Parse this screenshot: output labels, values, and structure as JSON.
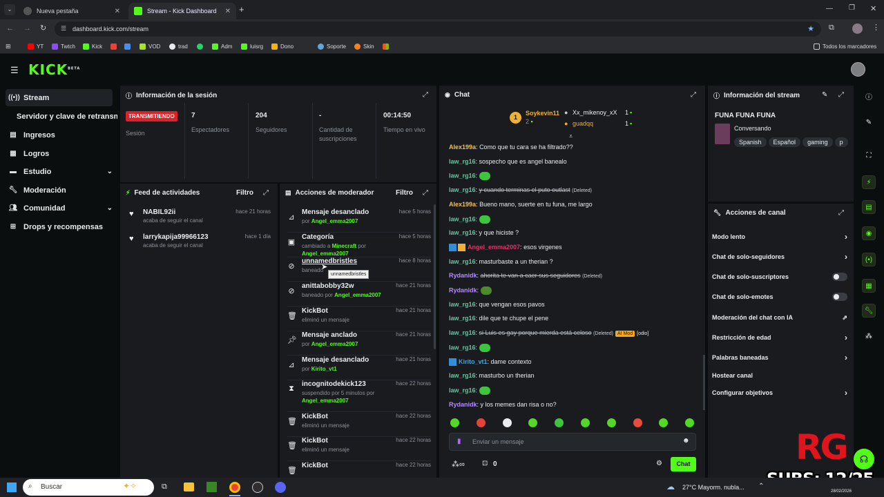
{
  "browser": {
    "tabs": [
      {
        "title": "Nueva pestaña",
        "active": false
      },
      {
        "title": "Stream - Kick Dashboard",
        "active": true
      }
    ],
    "url": "dashboard.kick.com/stream",
    "bookmarks": [
      "YT",
      "Twtch",
      "Kick",
      "VOD",
      "trad",
      "Adm",
      "luisrg",
      "Dono",
      "Soporte",
      "Skin"
    ],
    "bookmarks_all": "Todos los marcadores"
  },
  "app": {
    "logo": "KICK",
    "logo_badge": "BETA"
  },
  "sidebar": {
    "items": [
      {
        "label": "Stream",
        "icon": "broadcast-icon"
      },
      {
        "label": "Servidor y clave de retransm",
        "icon": ""
      },
      {
        "label": "Ingresos",
        "icon": "card-icon"
      },
      {
        "label": "Logros",
        "icon": "grid-icon"
      },
      {
        "label": "Estudio",
        "icon": "studio-icon"
      },
      {
        "label": "Moderación",
        "icon": "wrench-icon"
      },
      {
        "label": "Comunidad",
        "icon": "people-icon"
      },
      {
        "label": "Drops y recompensas",
        "icon": "gift-icon"
      }
    ]
  },
  "session": {
    "title": "Información de la sesión",
    "live_badge": "TRANSMITIENDO",
    "session_label": "Sesión",
    "stats": [
      {
        "value": "7",
        "label": "Espectadores"
      },
      {
        "value": "204",
        "label": "Seguidores"
      },
      {
        "value": "-",
        "label": "Cantidad de suscripciones"
      },
      {
        "value": "00:14:50",
        "label": "Tiempo en vivo"
      }
    ]
  },
  "feed": {
    "title": "Feed de actividades",
    "filter": "Filtro",
    "items": [
      {
        "name": "NABIL92ii",
        "action": "acaba de seguir el canal",
        "time": "hace 21 horas"
      },
      {
        "name": "larrykapija99966123",
        "action": "acaba de seguir el canal",
        "time": "hace 1 día"
      }
    ]
  },
  "mod_actions": {
    "title": "Acciones de moderador",
    "filter": "Filtro",
    "tooltip": "unnamedbristles",
    "items": [
      {
        "title": "Mensaje desanclado",
        "sub_pre": "por ",
        "sub_user": "Angel_emma2007",
        "sub_mid": "",
        "sub_user2": "",
        "time": "hace 5 horas",
        "icon": "unpin-icon"
      },
      {
        "title": "Categoría",
        "sub_pre": "cambiado a ",
        "sub_user": "Minecraft",
        "sub_mid": " por ",
        "sub_user2": "Angel_emma2007",
        "time": "hace 5 horas",
        "icon": "category-icon"
      },
      {
        "title": "unnamedbristles",
        "sub_pre": "baneado",
        "sub_user": "",
        "sub_mid": "",
        "sub_user2": "",
        "time": "hace 8 horas",
        "icon": "ban-icon"
      },
      {
        "title": "anittabobby32w",
        "sub_pre": "baneado por ",
        "sub_user": "Angel_emma2007",
        "sub_mid": "",
        "sub_user2": "",
        "time": "hace 21 horas",
        "icon": "ban-icon"
      },
      {
        "title": "KickBot",
        "sub_pre": "eliminó un mensaje",
        "sub_user": "",
        "sub_mid": "",
        "sub_user2": "",
        "time": "hace 21 horas",
        "icon": "trash-icon"
      },
      {
        "title": "Mensaje anclado",
        "sub_pre": "por ",
        "sub_user": "Angel_emma2007",
        "sub_mid": "",
        "sub_user2": "",
        "time": "hace 21 horas",
        "icon": "pin-icon"
      },
      {
        "title": "Mensaje desanclado",
        "sub_pre": "por ",
        "sub_user": "Kirito_vt1",
        "sub_mid": "",
        "sub_user2": "",
        "time": "hace 21 horas",
        "icon": "unpin-icon"
      },
      {
        "title": "incognitodekick123",
        "sub_pre": "suspendido por 5 minutos por ",
        "sub_user": "Angel_emma2007",
        "sub_mid": "",
        "sub_user2": "",
        "time": "hace 22 horas",
        "icon": "hourglass-icon"
      },
      {
        "title": "KickBot",
        "sub_pre": "eliminó un mensaje",
        "sub_user": "",
        "sub_mid": "",
        "sub_user2": "",
        "time": "hace 22 horas",
        "icon": "trash-icon"
      },
      {
        "title": "KickBot",
        "sub_pre": "eliminó un mensaje",
        "sub_user": "",
        "sub_mid": "",
        "sub_user2": "",
        "time": "hace 22 horas",
        "icon": "trash-icon"
      },
      {
        "title": "KickBot",
        "sub_pre": "",
        "sub_user": "",
        "sub_mid": "",
        "sub_user2": "",
        "time": "hace 22 horas",
        "icon": "trash-icon"
      }
    ]
  },
  "chat": {
    "title": "Chat",
    "leaders": [
      {
        "name": "Soykevin11",
        "count": "2"
      },
      {
        "name": "Xx_mikenoy_xX",
        "count": "1"
      },
      {
        "name": "guadqq",
        "count": "1"
      }
    ],
    "rank_badge": "1",
    "messages": [
      {
        "user": "Alex199a",
        "color": "#f2c14e",
        "text": "Como que tu cara se ha filtrado??",
        "deleted": false,
        "note": "",
        "emote": false
      },
      {
        "user": "law_rg16",
        "color": "#6cc3a0",
        "text": "sospecho que es angel banealo",
        "deleted": false,
        "note": "",
        "emote": false
      },
      {
        "user": "law_rg16",
        "color": "#6cc3a0",
        "text": "",
        "deleted": false,
        "note": "",
        "emote": true
      },
      {
        "user": "law_rg16",
        "color": "#6cc3a0",
        "text": "y cuando terminas el puto outlast",
        "deleted": true,
        "note": "(Deleted)",
        "emote": false
      },
      {
        "user": "Alex199a",
        "color": "#f2c14e",
        "text": "Bueno mano, suerte en tu funa, me largo",
        "deleted": false,
        "note": "",
        "emote": false
      },
      {
        "user": "law_rg16",
        "color": "#6cc3a0",
        "text": "",
        "deleted": false,
        "note": "",
        "emote": true
      },
      {
        "user": "law_rg16",
        "color": "#6cc3a0",
        "text": "y que hiciste ?",
        "deleted": false,
        "note": "",
        "emote": false
      },
      {
        "user": "Angel_emma2007",
        "color": "#e0356a",
        "text": "esos virgenes",
        "deleted": false,
        "note": "",
        "emote": false
      },
      {
        "user": "law_rg16",
        "color": "#6cc3a0",
        "text": "masturbaste a un therian ?",
        "deleted": false,
        "note": "",
        "emote": false
      },
      {
        "user": "Rydanidk",
        "color": "#b58cff",
        "text": "ahorita te van a caer sus seguidores",
        "deleted": true,
        "note": "(Deleted)",
        "emote": false
      },
      {
        "user": "Rydanidk",
        "color": "#b58cff",
        "text": "",
        "deleted": false,
        "note": "",
        "emote": true
      },
      {
        "user": "law_rg16",
        "color": "#6cc3a0",
        "text": "que vengan esos pavos",
        "deleted": false,
        "note": "",
        "emote": false
      },
      {
        "user": "law_rg16",
        "color": "#6cc3a0",
        "text": "dile que te chupe el pene",
        "deleted": false,
        "note": "",
        "emote": false
      },
      {
        "user": "law_rg16",
        "color": "#6cc3a0",
        "text": "si Luis es gay porque mierda está celoso",
        "deleted": true,
        "note": "(Deleted)",
        "emote": false
      },
      {
        "user": "law_rg16",
        "color": "#6cc3a0",
        "text": "",
        "deleted": false,
        "note": "",
        "emote": true
      },
      {
        "user": "Kirito_vt1",
        "color": "#3fa7e0",
        "text": "dame contexto",
        "deleted": false,
        "note": "",
        "emote": false
      },
      {
        "user": "law_rg16",
        "color": "#6cc3a0",
        "text": "masturbo un therian",
        "deleted": false,
        "note": "",
        "emote": false
      },
      {
        "user": "law_rg16",
        "color": "#6cc3a0",
        "text": "",
        "deleted": false,
        "note": "",
        "emote": true
      },
      {
        "user": "Rydanidk",
        "color": "#b58cff",
        "text": "y los memes dan risa o no?",
        "deleted": false,
        "note": "",
        "emote": false
      }
    ],
    "ai_mod_badge": "AI Mod",
    "ai_mod_tag": "[odio]",
    "input_placeholder": "Enviar un mensaje",
    "points_count": "0",
    "send_label": "Chat"
  },
  "stream_info": {
    "title": "Información del stream",
    "stream_title": "FUNA FUNA FUNA",
    "category": "Conversando",
    "tags": [
      "Spanish",
      "Español",
      "gaming",
      "p"
    ]
  },
  "channel_actions": {
    "title": "Acciones de canal",
    "items": [
      {
        "label": "Modo lento",
        "control": "chevron"
      },
      {
        "label": "Chat de solo-seguidores",
        "control": "chevron"
      },
      {
        "label": "Chat de solo-suscriptores",
        "control": "toggle"
      },
      {
        "label": "Chat de solo-emotes",
        "control": "toggle"
      },
      {
        "label": "Moderación del chat con IA",
        "control": "external"
      },
      {
        "label": "Restricción de edad",
        "control": "chevron"
      },
      {
        "label": "Palabras baneadas",
        "control": "chevron"
      },
      {
        "label": "Hostear canal",
        "control": "none"
      },
      {
        "label": "Configurar objetivos",
        "control": "chevron"
      }
    ]
  },
  "overlay": {
    "logo": "RG",
    "subs": "SUBS: 12/25"
  },
  "taskbar": {
    "search": "Buscar",
    "weather": "27°C  Mayorm. nubla...",
    "date": "28/02/2026"
  },
  "colors": {
    "accent": "#53fc18",
    "live": "#d8232a",
    "panel": "#191b1f",
    "bg": "#0b0e0f"
  }
}
